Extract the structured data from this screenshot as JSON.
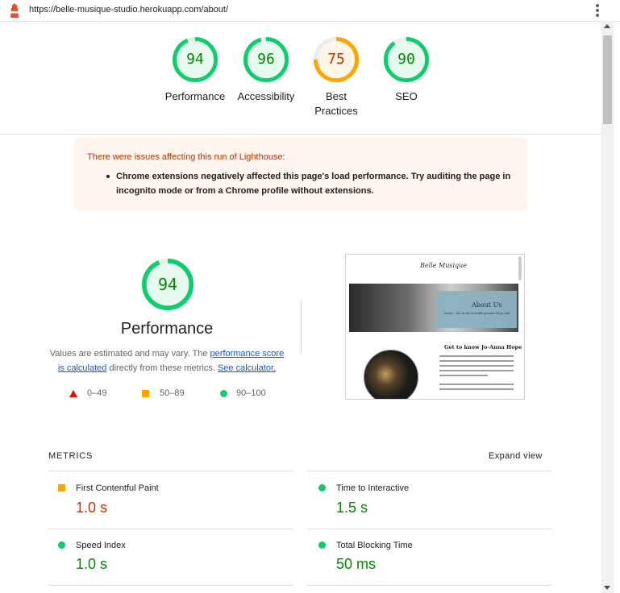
{
  "url_bar": {
    "url": "https://belle-musique-studio.herokuapp.com/about/"
  },
  "colors": {
    "pass": "#0cce6b",
    "pass_text": "#008800",
    "average": "#ffa400",
    "average_text": "#c33300",
    "fail": "#eb0f00",
    "link": "#1a56c7"
  },
  "scores": [
    {
      "label": "Performance",
      "value": "94",
      "fraction": 0.94,
      "rating": "pass"
    },
    {
      "label": "Accessibility",
      "value": "96",
      "fraction": 0.96,
      "rating": "pass"
    },
    {
      "label": "Best Practices",
      "value": "75",
      "fraction": 0.75,
      "rating": "average"
    },
    {
      "label": "SEO",
      "value": "90",
      "fraction": 0.9,
      "rating": "pass"
    }
  ],
  "warning": {
    "title": "There were issues affecting this run of Lighthouse:",
    "message": "Chrome extensions negatively affected this page's load performance. Try auditing the page in incognito mode or from a Chrome profile without extensions."
  },
  "performance": {
    "score": "94",
    "score_fraction": 0.94,
    "title": "Performance",
    "desc_prefix": "Values are estimated and may vary. The ",
    "link1": "performance score is calculated",
    "desc_middle": " directly from these metrics. ",
    "link2": "See calculator."
  },
  "legend": [
    {
      "shape": "triangle",
      "range": "0–49"
    },
    {
      "shape": "square",
      "range": "50–89"
    },
    {
      "shape": "circle",
      "range": "90–100"
    }
  ],
  "screenshot": {
    "logo": "Belle Musique",
    "hero_heading": "About Us",
    "hero_sub": "Music... life in the invisible passion of joy and",
    "section_heading": "Get to know Jo-Anna Hope"
  },
  "metrics": {
    "title": "METRICS",
    "expand_label": "Expand view",
    "items": [
      {
        "name": "First Contentful Paint",
        "value": "1.0 s",
        "rating": "average"
      },
      {
        "name": "Time to Interactive",
        "value": "1.5 s",
        "rating": "pass"
      },
      {
        "name": "Speed Index",
        "value": "1.0 s",
        "rating": "pass"
      },
      {
        "name": "Total Blocking Time",
        "value": "50 ms",
        "rating": "pass"
      }
    ]
  }
}
